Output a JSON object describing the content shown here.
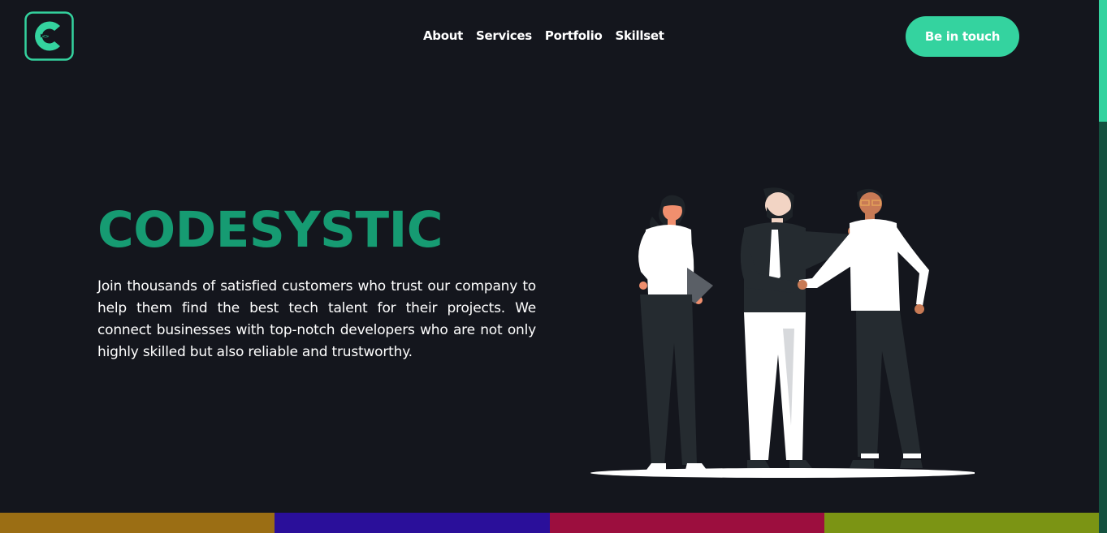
{
  "header": {
    "logo_icon": "codesystic-c-logo",
    "nav": [
      "About",
      "Services",
      "Portfolio",
      "Skillset"
    ],
    "cta_label": "Be in touch"
  },
  "hero": {
    "title": "CODESYSTIC",
    "description": "Join thousands of satisfied customers who trust our company to help them find the best tech talent for their projects. We connect businesses with top-notch developers who are not only highly skilled but also reliable and trustworthy."
  },
  "colors": {
    "accent": "#34d39f",
    "title": "#169b72",
    "background": "#14161d",
    "bottom_bars": [
      "#9b6e14",
      "#2a0f9a",
      "#9c0e3e",
      "#7b9414"
    ]
  }
}
